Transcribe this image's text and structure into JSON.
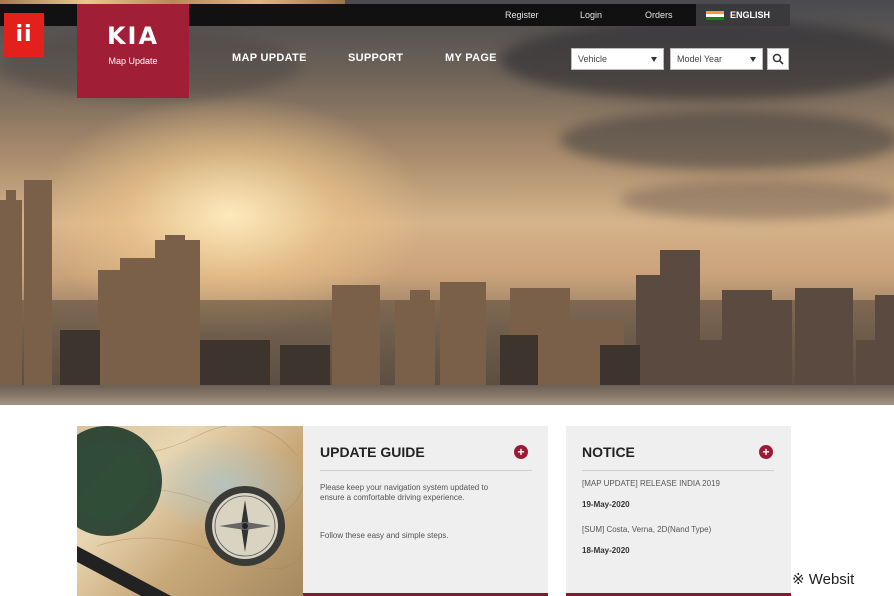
{
  "badge": {
    "label": "ii"
  },
  "top_bar": {
    "links": [
      "Register",
      "Login",
      "Orders"
    ],
    "language": "ENGLISH"
  },
  "logo": {
    "brand": "KIA",
    "subtitle": "Map Update"
  },
  "nav": {
    "items": [
      "MAP UPDATE",
      "SUPPORT",
      "MY PAGE"
    ]
  },
  "search": {
    "vehicle_select": "Vehicle",
    "model_year_select": "Model Year",
    "search_icon": "search-icon"
  },
  "update_guide": {
    "title": "UPDATE GUIDE",
    "paragraph1": "Please keep your navigation system updated to ensure a comfortable driving experience.",
    "paragraph2": "Follow these easy and simple steps."
  },
  "notice": {
    "title": "NOTICE",
    "items": [
      {
        "text": "[MAP UPDATE] RELEASE INDIA 2019",
        "date": "19-May-2020"
      },
      {
        "text": "[SUM] Costa, Verna, 2D(Nand Type)",
        "date": "18-May-2020"
      }
    ]
  },
  "side_note": "※ Websit",
  "colors": {
    "brand": "#a01f36",
    "badge": "#e3201c",
    "accent_bar": "#7a1d33"
  }
}
